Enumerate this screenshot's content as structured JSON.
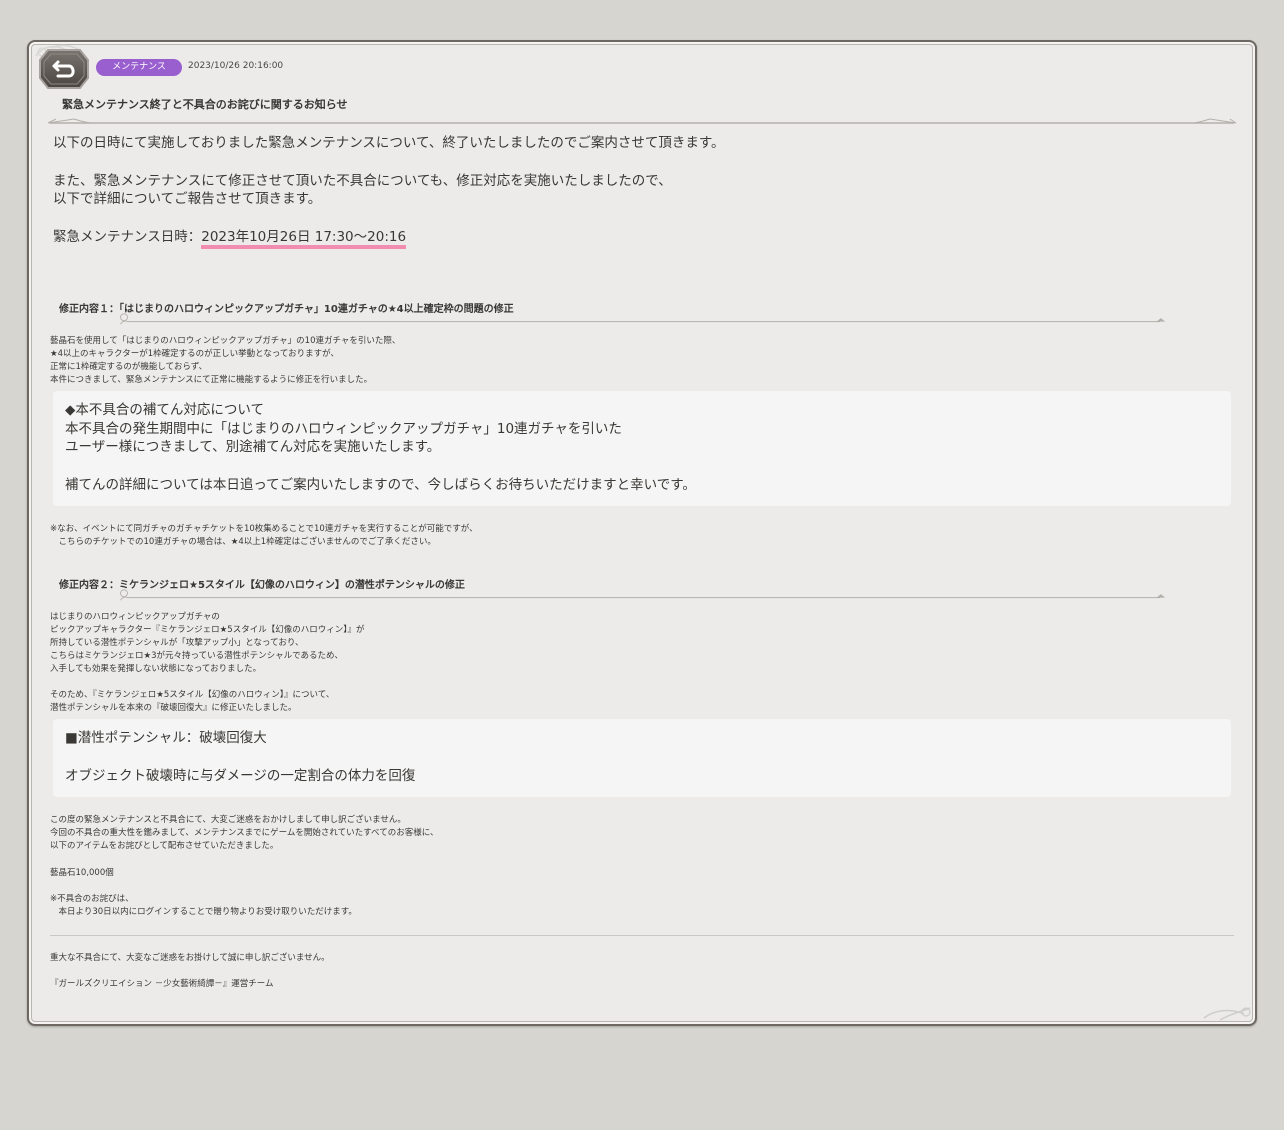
{
  "header": {
    "category_badge": "メンテナンス",
    "date": "2023/10/26 20:16:00",
    "title": "緊急メンテナンス終了と不具合のお詫びに関するお知らせ",
    "badge_color": "#9a5fcf"
  },
  "intro": {
    "line1": "以下の日時にて実施しておりました緊急メンテナンスについて、終了いたしましたのでご案内させて頂きます。",
    "line2": "また、緊急メンテナンスにて修正させて頂いた不具合についても、修正対応を実施いたしましたので、",
    "line3": "以下で詳細についてご報告させて頂きます。",
    "maint_label": "緊急メンテナンス日時：",
    "maint_time": "2023年10月26日 17:30～20:16"
  },
  "section1": {
    "title": "修正内容１：「はじまりのハロウィンピックアップガチャ」10連ガチャの★4以上確定枠の問題の修正",
    "body": [
      "藝晶石を使用して「はじまりのハロウィンピックアップガチャ」の10連ガチャを引いた際、",
      "★4以上のキャラクターが1枠確定するのが正しい挙動となっておりますが、",
      "正常に1枠確定するのが機能しておらず、",
      "本件につきまして、緊急メンテナンスにて正常に機能するように修正を行いました。"
    ],
    "box": [
      "◆本不具合の補てん対応について",
      "本不具合の発生期間中に「はじまりのハロウィンピックアップガチャ」10連ガチャを引いた",
      "ユーザー様につきまして、別途補てん対応を実施いたします。",
      "",
      "補てんの詳細については本日追ってご案内いたしますので、今しばらくお待ちいただけますと幸いです。"
    ],
    "note": [
      "※なお、イベントにて同ガチャのガチャチケットを10枚集めることで10連ガチャを実行することが可能ですが、",
      "　こちらのチケットでの10連ガチャの場合は、★4以上1枠確定はございませんのでご了承ください。"
    ]
  },
  "section2": {
    "title": "修正内容２：ミケランジェロ★5スタイル【幻像のハロウィン】の潜性ポテンシャルの修正",
    "body": [
      "はじまりのハロウィンピックアップガチャの",
      "ピックアップキャラクター『ミケランジェロ★5スタイル【幻像のハロウィン】』が",
      "所持している潜性ポテンシャルが「攻撃アップ小」となっており、",
      "こちらはミケランジェロ★3が元々持っている潜性ポテンシャルであるため、",
      "入手しても効果を発揮しない状態になっておりました。",
      "",
      "そのため、『ミケランジェロ★5スタイル【幻像のハロウィン】』について、",
      "潜性ポテンシャルを本来の『破壊回復大』に修正いたしました。"
    ],
    "box": [
      "■潜性ポテンシャル：破壊回復大",
      "",
      "オブジェクト破壊時に与ダメージの一定割合の体力を回復"
    ]
  },
  "apology": {
    "body": [
      "この度の緊急メンテナンスと不具合にて、大変ご迷惑をおかけしまして申し訳ございません。",
      "今回の不具合の重大性を鑑みまして、メンテナンスまでにゲームを開始されていたすべてのお客様に、",
      "以下のアイテムをお詫びとして配布させていただきました。",
      "",
      "藝晶石10,000個",
      "",
      "※不具合のお詫びは、",
      "　本日より30日以内にログインすることで贈り物よりお受け取りいただけます。"
    ]
  },
  "footer": {
    "line1": "重大な不具合にて、大変なご迷惑をお掛けして誠に申し訳ございません。",
    "line2": "『ガールズクリエイション －少女藝術綺譚－』運営チーム"
  }
}
